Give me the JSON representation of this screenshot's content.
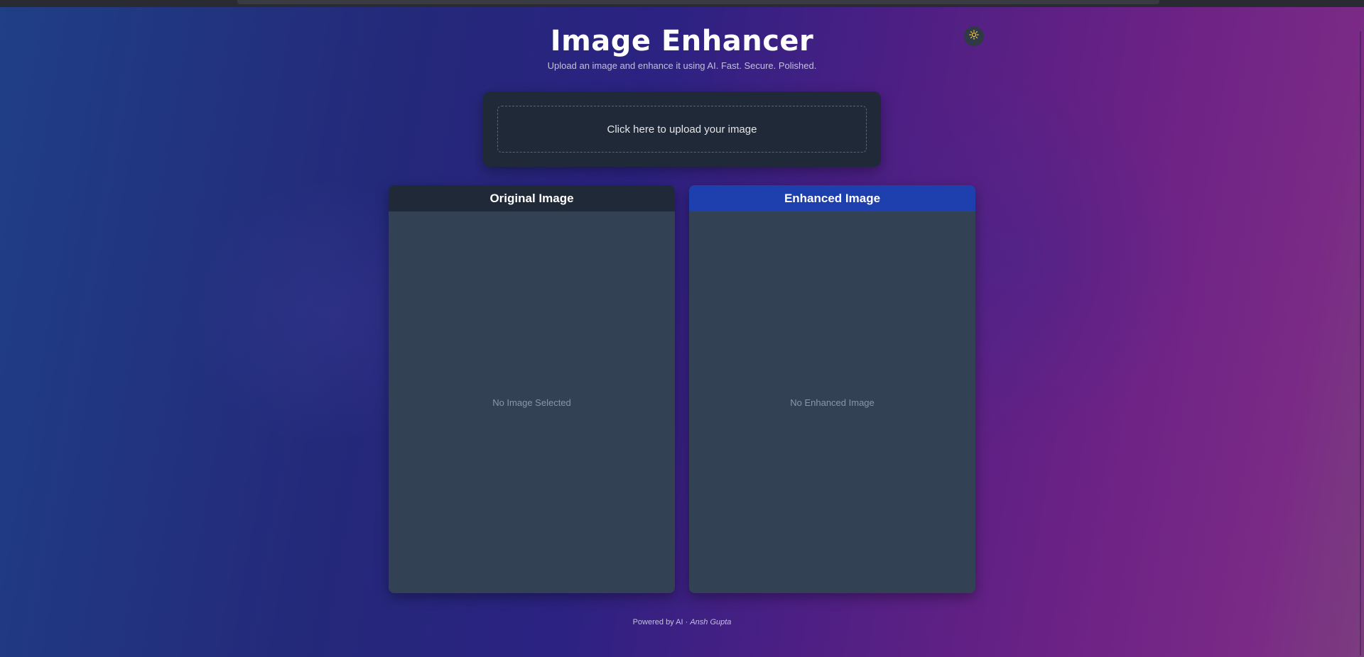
{
  "header": {
    "title": "Image Enhancer",
    "subtitle": "Upload an image and enhance it using AI. Fast. Secure. Polished.",
    "theme_toggle_icon": "sun-icon"
  },
  "upload": {
    "label": "Click here to upload your image"
  },
  "panels": {
    "original": {
      "title": "Original Image",
      "empty_text": "No Image Selected"
    },
    "enhanced": {
      "title": "Enhanced Image",
      "empty_text": "No Enhanced Image"
    }
  },
  "footer": {
    "prefix": "Powered by AI · ",
    "author": "Ansh Gupta"
  },
  "colors": {
    "card_bg": "#1f2937",
    "panel_body": "#334155",
    "enhanced_header": "#1e40af",
    "sun_icon": "#f5c842"
  }
}
